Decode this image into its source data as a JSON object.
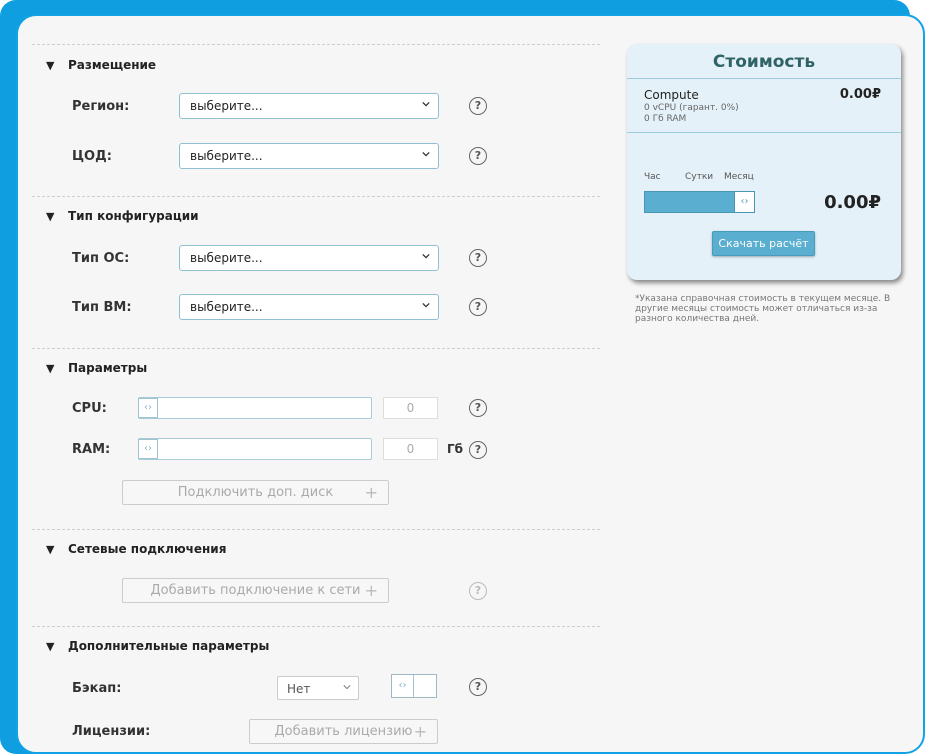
{
  "sections": {
    "placement": {
      "title": "Размещение",
      "region": {
        "label": "Регион:",
        "value": "выберите..."
      },
      "dc": {
        "label": "ЦОД:",
        "value": "выберите..."
      }
    },
    "config": {
      "title": "Тип конфигурации",
      "os": {
        "label": "Тип ОС:",
        "value": "выберите..."
      },
      "vm": {
        "label": "Тип ВМ:",
        "value": "выберите..."
      }
    },
    "params": {
      "title": "Параметры",
      "cpu": {
        "label": "CPU:",
        "value": "0"
      },
      "ram": {
        "label": "RAM:",
        "value": "0",
        "unit": "Гб"
      },
      "add_disk_label": "Подключить доп. диск"
    },
    "network": {
      "title": "Сетевые подключения",
      "add_network_label": "Добавить подключение к сети"
    },
    "extra": {
      "title": "Дополнительные параметры",
      "backup": {
        "label": "Бэкап:",
        "value": "Нет"
      },
      "licenses": {
        "label": "Лицензии:",
        "add_label": "Добавить лицензию"
      }
    }
  },
  "help_glyph": "?",
  "plus_glyph": "+",
  "collapse_glyph": "▼",
  "cost": {
    "title": "Стоимость",
    "compute_name": "Compute",
    "compute_price": "0.00₽",
    "compute_vcpu": "0 vCPU (гарант. 0%)",
    "compute_ram": "0 Гб RAM",
    "periods": [
      "Час",
      "Сутки",
      "Месяц"
    ],
    "period_selected_fraction": 1.0,
    "total": "0.00₽",
    "download_label": "Скачать расчёт",
    "note": "*Указана справочная стоимость в текущем месяце. В другие месяцы стоимость может отличаться из-за разного количества дней."
  },
  "colors": {
    "accent": "#12a3e6",
    "button": "#5aaecf",
    "title": "#2f6367"
  }
}
